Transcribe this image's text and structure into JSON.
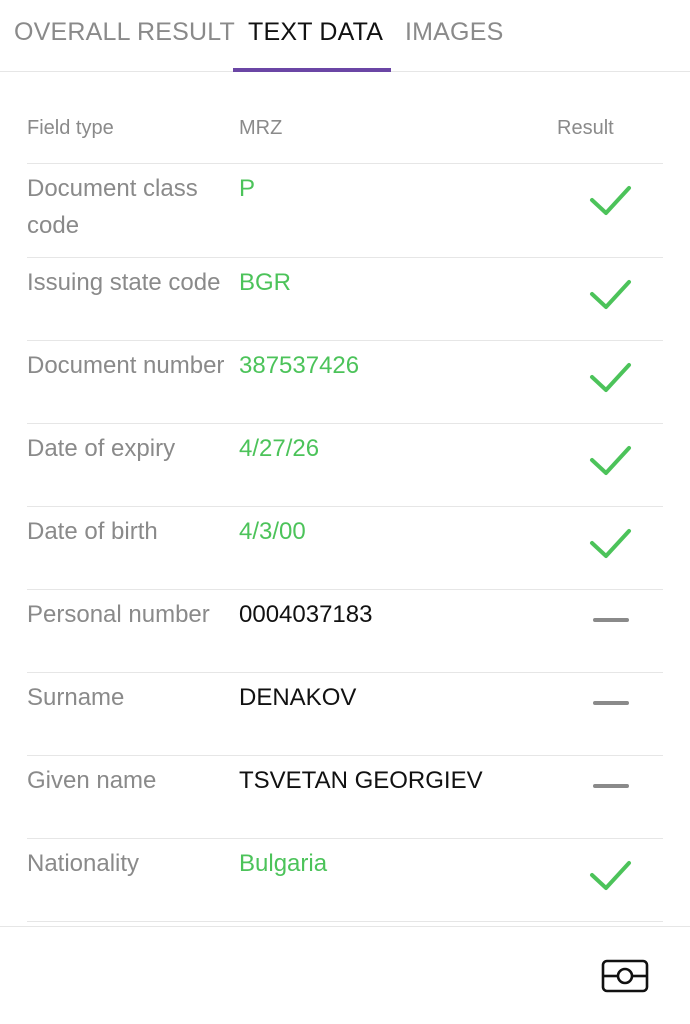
{
  "tabs": [
    {
      "label": "OVERALL RESULT",
      "active": false
    },
    {
      "label": "TEXT DATA",
      "active": true
    },
    {
      "label": "IMAGES",
      "active": false
    }
  ],
  "accent_color": "#6b46a5",
  "valid_color": "#4cc35a",
  "table": {
    "headers": {
      "field_type": "Field type",
      "mrz": "MRZ",
      "result": "Result"
    },
    "rows": [
      {
        "field": "Document class code",
        "value": "P",
        "status": "valid",
        "result_icon": "checkmark-icon"
      },
      {
        "field": "Issuing state code",
        "value": "BGR",
        "status": "valid",
        "result_icon": "checkmark-icon"
      },
      {
        "field": "Document number",
        "value": "387537426",
        "status": "valid",
        "result_icon": "checkmark-icon"
      },
      {
        "field": "Date of expiry",
        "value": "4/27/26",
        "status": "valid",
        "result_icon": "checkmark-icon"
      },
      {
        "field": "Date of birth",
        "value": "4/3/00",
        "status": "valid",
        "result_icon": "checkmark-icon"
      },
      {
        "field": "Personal number",
        "value": "0004037183",
        "status": "neutral",
        "result_icon": "dash-icon"
      },
      {
        "field": "Surname",
        "value": "DENAKOV",
        "status": "neutral",
        "result_icon": "dash-icon"
      },
      {
        "field": "Given name",
        "value": "TSVETAN GEORGIEV",
        "status": "neutral",
        "result_icon": "dash-icon"
      },
      {
        "field": "Nationality",
        "value": "Bulgaria",
        "status": "valid",
        "result_icon": "checkmark-icon"
      }
    ]
  },
  "footer": {
    "camera_icon": "camera-icon"
  }
}
